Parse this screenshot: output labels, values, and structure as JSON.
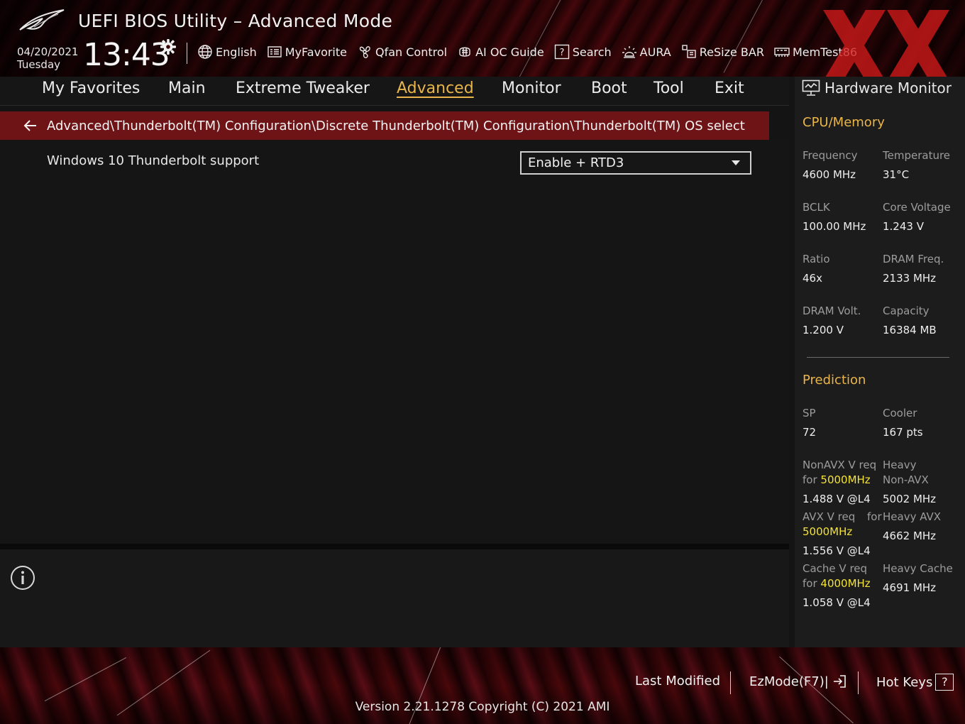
{
  "header": {
    "title": "UEFI BIOS Utility – Advanced Mode",
    "date": "04/20/2021",
    "day": "Tuesday",
    "time": "13:43",
    "tools": [
      {
        "label": "English",
        "icon": "globe-icon"
      },
      {
        "label": "MyFavorite",
        "icon": "favorite-list-icon"
      },
      {
        "label": "Qfan Control",
        "icon": "fan-icon"
      },
      {
        "label": "AI OC Guide",
        "icon": "ai-chip-icon"
      },
      {
        "label": "Search",
        "icon": "search-help-icon"
      },
      {
        "label": "AURA",
        "icon": "aura-light-icon"
      },
      {
        "label": "ReSize BAR",
        "icon": "resize-bar-icon"
      },
      {
        "label": "MemTest86",
        "icon": "memtest-icon"
      }
    ]
  },
  "nav": {
    "tabs": [
      "My Favorites",
      "Main",
      "Extreme Tweaker",
      "Advanced",
      "Monitor",
      "Boot",
      "Tool",
      "Exit"
    ],
    "active": "Advanced"
  },
  "breadcrumb": {
    "path": "Advanced\\Thunderbolt(TM) Configuration\\Discrete Thunderbolt(TM) Configuration\\Thunderbolt(TM) OS select"
  },
  "settings": [
    {
      "label": "Windows 10 Thunderbolt support",
      "value": "Enable + RTD3"
    }
  ],
  "hardware_monitor": {
    "title": "Hardware Monitor",
    "cpu_memory": {
      "section": "CPU/Memory",
      "frequency": {
        "label": "Frequency",
        "value": "4600 MHz"
      },
      "temperature": {
        "label": "Temperature",
        "value": "31°C"
      },
      "bclk": {
        "label": "BCLK",
        "value": "100.00 MHz"
      },
      "core_voltage": {
        "label": "Core Voltage",
        "value": "1.243 V"
      },
      "ratio": {
        "label": "Ratio",
        "value": "46x"
      },
      "dram_freq": {
        "label": "DRAM Freq.",
        "value": "2133 MHz"
      },
      "dram_volt": {
        "label": "DRAM Volt.",
        "value": "1.200 V"
      },
      "capacity": {
        "label": "Capacity",
        "value": "16384 MB"
      }
    },
    "prediction": {
      "section": "Prediction",
      "sp": {
        "label": "SP",
        "value": "72"
      },
      "cooler": {
        "label": "Cooler",
        "value": "167 pts"
      },
      "nonavx": {
        "label_a": "NonAVX V req",
        "label_for": "for",
        "freq": "5000MHz",
        "value": "1.488 V @L4"
      },
      "heavy_nonavx": {
        "label_a": "Heavy",
        "label_b": "Non-AVX",
        "value": "5002 MHz"
      },
      "avx": {
        "label_a": "AVX V req",
        "label_for": "for",
        "freq": "5000MHz",
        "value": "1.556 V @L4"
      },
      "heavy_avx": {
        "label": "Heavy AVX",
        "value": "4662 MHz"
      },
      "cache": {
        "label_a": "Cache V req",
        "label_for": "for",
        "freq": "4000MHz",
        "value": "1.058 V @L4"
      },
      "heavy_cache": {
        "label": "Heavy Cache",
        "value": "4691 MHz"
      }
    }
  },
  "footer": {
    "last_modified": "Last Modified",
    "ezmode": "EzMode(F7)|",
    "hotkeys": "Hot Keys",
    "hotkeys_key": "?",
    "version": "Version 2.21.1278 Copyright (C) 2021 AMI"
  },
  "colors": {
    "accent": "#e9b54a",
    "highlight": "#f2e23a",
    "breadcrumb_bg": "#6e1417",
    "panel_bg": "#1c1c1c"
  }
}
